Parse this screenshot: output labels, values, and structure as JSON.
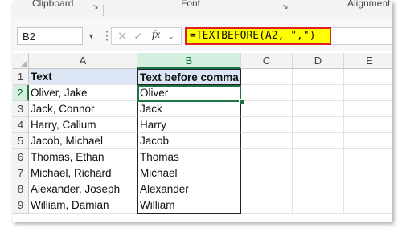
{
  "ribbon": {
    "groups": [
      "Clipboard",
      "Font",
      "Alignment"
    ]
  },
  "formula_bar": {
    "name_box": "B2",
    "fx_label": "fx",
    "formula": "=TEXTBEFORE(A2, \",\")"
  },
  "columns": [
    "A",
    "B",
    "C",
    "D",
    "E"
  ],
  "selected_column": "B",
  "rows": [
    "1",
    "2",
    "3",
    "4",
    "5",
    "6",
    "7",
    "8",
    "9"
  ],
  "selected_row": "2",
  "sheet": {
    "headers": [
      "Text",
      "Text before comma"
    ],
    "data": [
      [
        "Oliver, Jake",
        "Oliver"
      ],
      [
        "Jack, Connor",
        "Jack"
      ],
      [
        "Harry, Callum",
        "Harry"
      ],
      [
        "Jacob, Michael",
        "Jacob"
      ],
      [
        "Thomas, Ethan",
        "Thomas"
      ],
      [
        "Michael, Richard",
        "Michael"
      ],
      [
        "Alexander, Joseph",
        "Alexander"
      ],
      [
        "William, Damian",
        "William"
      ]
    ]
  },
  "colors": {
    "header_fill": "#dce6f5",
    "formula_highlight": "#ffff00",
    "formula_border": "#e02020",
    "selection": "#217346"
  }
}
